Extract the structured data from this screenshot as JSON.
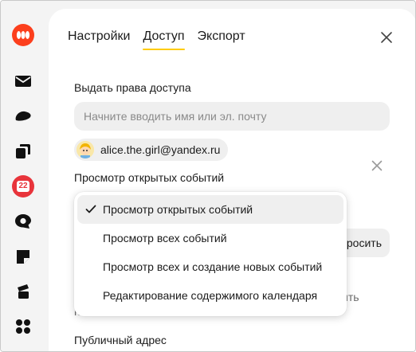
{
  "rail": {
    "icons": [
      "app-logo-icon",
      "mail-icon",
      "disk-icon",
      "docs-icon",
      "calendar-icon",
      "messenger-icon",
      "notes-icon",
      "projects-icon",
      "all-services-icon"
    ],
    "calendar_day": "22",
    "colors": {
      "logo": "#fc3f1d",
      "calendar": "#e8343b"
    }
  },
  "tabs": [
    {
      "label": "Настройки"
    },
    {
      "label": "Доступ"
    },
    {
      "label": "Экспорт"
    }
  ],
  "access": {
    "grant_label": "Выдать права доступа",
    "search_placeholder": "Начните вводить имя или эл. почту",
    "user_email": "alice.the.girl@yandex.ru",
    "permission_label": "Просмотр открытых событий",
    "request_button_partial": "росить",
    "partial_text_right": "ить",
    "partial_text_left": "н",
    "public_address_label": "Публичный адрес"
  },
  "dropdown": {
    "options": [
      {
        "label": "Просмотр открытых событий",
        "selected": true
      },
      {
        "label": "Просмотр всех событий",
        "selected": false
      },
      {
        "label": "Просмотр всех и создание новых событий",
        "selected": false
      },
      {
        "label": "Редактирование содержимого календаря",
        "selected": false
      }
    ]
  },
  "colors": {
    "accent": "#ffcc00"
  }
}
